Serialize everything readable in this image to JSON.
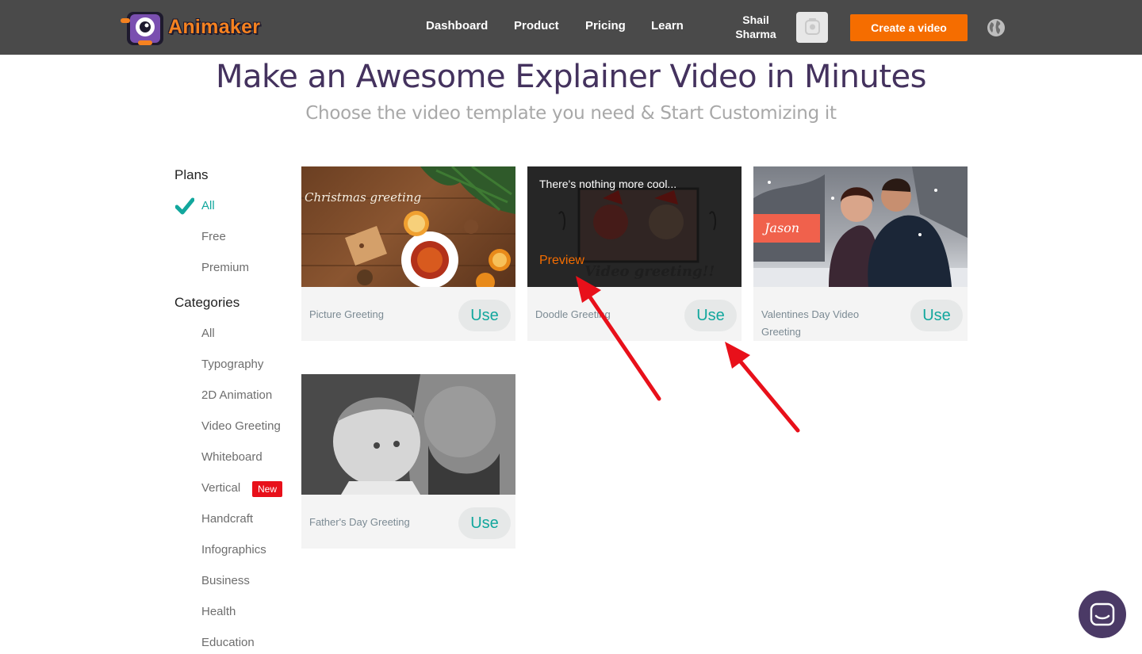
{
  "navbar": {
    "logo_text": "Animaker",
    "links": [
      "Dashboard",
      "Product",
      "Pricing",
      "Learn"
    ],
    "user_name_first": "Shail",
    "user_name_last": "Sharma",
    "create_button": "Create a video"
  },
  "hero": {
    "title": "Make an Awesome Explainer Video in Minutes",
    "subtitle": "Choose the video template you need & Start Customizing it"
  },
  "sidebar": {
    "plans_heading": "Plans",
    "plans": [
      "All",
      "Free",
      "Premium"
    ],
    "categories_heading": "Categories",
    "categories": [
      "All",
      "Typography",
      "2D Animation",
      "Video Greeting",
      "Whiteboard",
      "Vertical",
      "Handcraft",
      "Infographics",
      "Business",
      "Health",
      "Education"
    ],
    "new_badge": "New"
  },
  "cards": [
    {
      "label": "Picture Greeting",
      "use": "Use",
      "thumb_text": "Christmas greeting"
    },
    {
      "label": "Doodle Greeting",
      "use": "Use",
      "thumb_title": "There's nothing more cool...",
      "preview": "Preview",
      "thumb_text": "Video greeting!!"
    },
    {
      "label": "Valentines Day Video Greeting",
      "use": "Use",
      "thumb_text": "Jason"
    },
    {
      "label": "Father's Day Greeting",
      "use": "Use"
    }
  ],
  "colors": {
    "navbar_bg": "#4a4a4a",
    "accent_orange": "#f56d00",
    "accent_teal": "#12a79d",
    "title_purple": "#44325e",
    "annotation_red": "#e8101a"
  }
}
